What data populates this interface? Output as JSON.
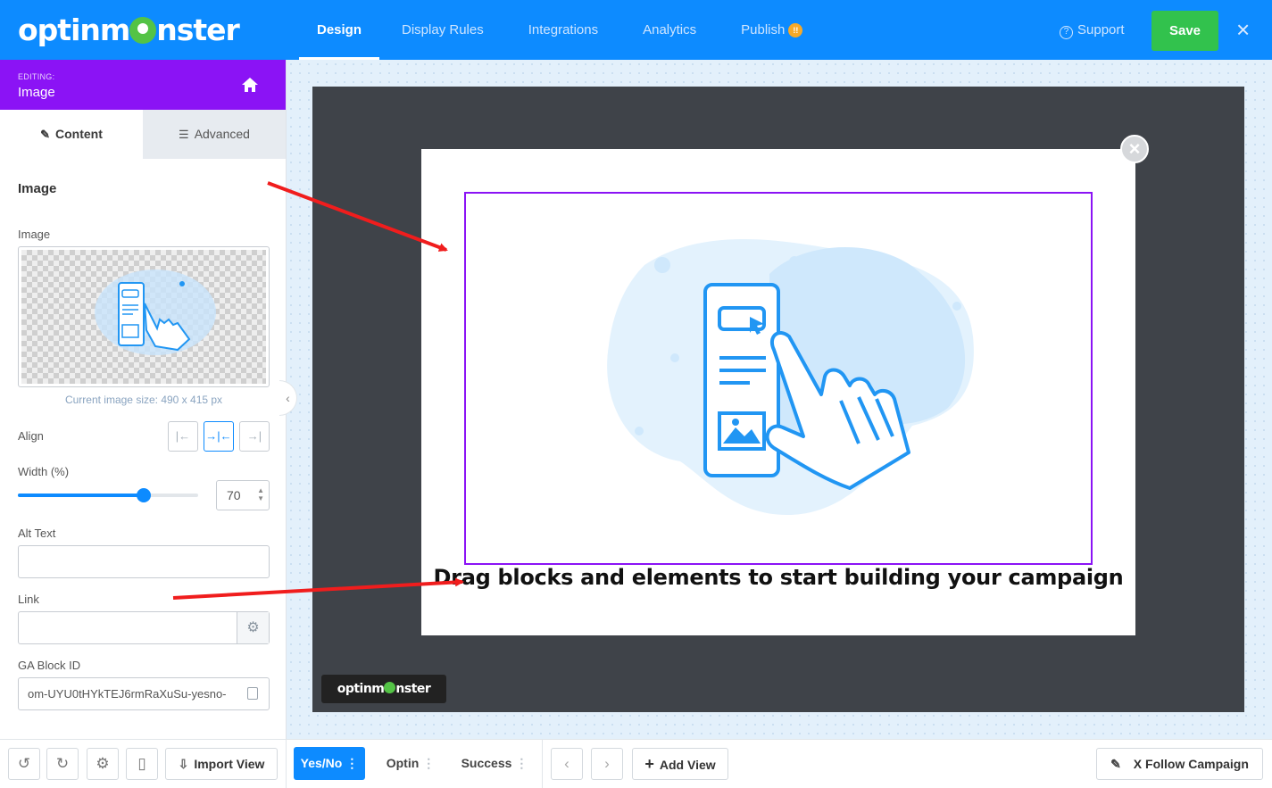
{
  "topbar": {
    "logo_text_a": "optinm",
    "logo_text_b": "nster",
    "nav": [
      {
        "label": "Design",
        "active": true
      },
      {
        "label": "Display Rules",
        "active": false
      },
      {
        "label": "Integrations",
        "active": false
      },
      {
        "label": "Analytics",
        "active": false
      },
      {
        "label": "Publish",
        "active": false
      }
    ],
    "publish_badge": "!!",
    "support_label": "Support",
    "save_label": "Save",
    "close_glyph": "×"
  },
  "sidebar": {
    "editing_label": "EDITING:",
    "editing_name": "Image",
    "tabs": [
      {
        "label": "Content",
        "icon": "pencil-icon",
        "active": true
      },
      {
        "label": "Advanced",
        "icon": "sliders-icon",
        "active": false
      }
    ],
    "section_title": "Image",
    "image_label": "Image",
    "image_size_text": "Current image size: 490 x 415 px",
    "align_label": "Align",
    "align_selected": "center",
    "width_label": "Width (%)",
    "width_value": "70",
    "width_fraction": 0.7,
    "alt_label": "Alt Text",
    "alt_value": "",
    "link_label": "Link",
    "link_value": "",
    "ga_label": "GA Block ID",
    "ga_value": "om-UYU0tHYkTEJ6rmRaXuSu-yesno-"
  },
  "canvas": {
    "popup_text": "Drag blocks and elements to start building your campaign",
    "powered_a": "optinm",
    "powered_b": "nster",
    "accent_color": "#8b13f5"
  },
  "bottombar": {
    "import_label": "Import View",
    "views": [
      {
        "label": "Yes/No",
        "active": true
      },
      {
        "label": "Optin",
        "active": false
      },
      {
        "label": "Success",
        "active": false
      }
    ],
    "add_view_label": "Add View",
    "follow_label": "X Follow Campaign"
  },
  "colors": {
    "brand_blue": "#0d8bff",
    "purple": "#8b13f5",
    "save_green": "#32c24d"
  }
}
